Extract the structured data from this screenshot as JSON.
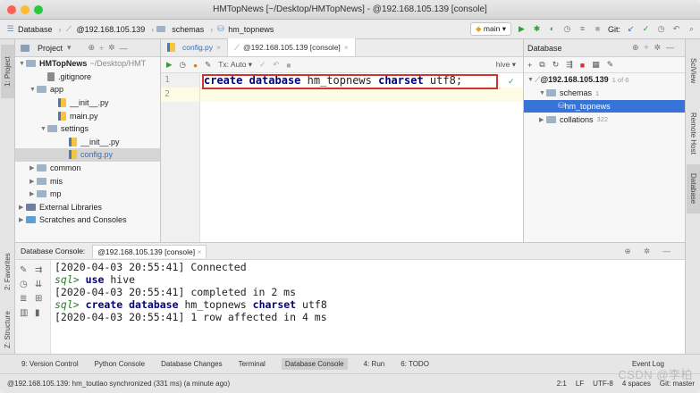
{
  "window": {
    "title": "HMTopNews [~/Desktop/HMTopNews] - @192.168.105.139 [console]"
  },
  "navbar": {
    "crumbs": [
      "Database",
      "@192.168.105.139",
      "schemas",
      "hm_topnews"
    ],
    "branch": "main",
    "git_label": "Git:"
  },
  "project": {
    "header": "Project",
    "items": [
      {
        "label": "HMTopNews",
        "suffix": "~/Desktop/HMT",
        "type": "folder",
        "indent": 0,
        "open": true
      },
      {
        "label": ".gitignore",
        "type": "file",
        "indent": 2
      },
      {
        "label": "app",
        "type": "folder",
        "indent": 1,
        "open": true
      },
      {
        "label": "__init__.py",
        "type": "py",
        "indent": 3
      },
      {
        "label": "main.py",
        "type": "py",
        "indent": 3
      },
      {
        "label": "settings",
        "type": "folder",
        "indent": 2,
        "open": true
      },
      {
        "label": "__init__.py",
        "type": "py",
        "indent": 4
      },
      {
        "label": "config.py",
        "type": "py",
        "indent": 4,
        "selected": true
      },
      {
        "label": "common",
        "type": "folder",
        "indent": 1
      },
      {
        "label": "mis",
        "type": "folder",
        "indent": 1
      },
      {
        "label": "mp",
        "type": "folder",
        "indent": 1
      },
      {
        "label": "External Libraries",
        "type": "lib",
        "indent": 0
      },
      {
        "label": "Scratches and Consoles",
        "type": "scratch",
        "indent": 0
      }
    ]
  },
  "editor": {
    "tabs": [
      {
        "label": "config.py",
        "active": false
      },
      {
        "label": "@192.168.105.139 [console]",
        "active": true
      }
    ],
    "tx": "Tx: Auto",
    "schema": "hive",
    "line_numbers": [
      "1",
      "2"
    ],
    "code": {
      "kw1": "create",
      "kw2": "database",
      "name": "hm_topnews",
      "kw3": "charset",
      "rest": "utf8;"
    }
  },
  "db_panel": {
    "header": "Database",
    "items": [
      {
        "label": "@192.168.105.139",
        "extra": "1 of 6",
        "indent": 0
      },
      {
        "label": "schemas",
        "extra": "1",
        "indent": 1
      },
      {
        "label": "hm_topnews",
        "extra": "",
        "indent": 2,
        "selected": true
      },
      {
        "label": "collations",
        "extra": "322",
        "indent": 1
      }
    ]
  },
  "console": {
    "tabs_label": "Database Console:",
    "tab": "@192.168.105.139 [console]",
    "lines": [
      {
        "kind": "log",
        "text": "[2020-04-03 20:55:41] Connected"
      },
      {
        "kind": "cmd",
        "prompt": "sql>",
        "kw": "use",
        "rest": "hive"
      },
      {
        "kind": "log",
        "text": "[2020-04-03 20:55:41] completed in 2 ms"
      },
      {
        "kind": "cmd2",
        "prompt": "sql>",
        "kw1": "create",
        "kw2": "database",
        "name": "hm_topnews",
        "kw3": "charset",
        "rest": "utf8"
      },
      {
        "kind": "log",
        "text": "[2020-04-03 20:55:41] 1 row affected in 4 ms"
      }
    ]
  },
  "left_tabs": [
    "1: Project",
    "2: Favorites",
    "Z: Structure"
  ],
  "right_tabs": [
    "SciView",
    "Remote Host",
    "Database"
  ],
  "bottom_tabs": [
    "9: Version Control",
    "Python Console",
    "Database Changes",
    "Terminal",
    "Database Console",
    "4: Run",
    "6: TODO",
    "Event Log"
  ],
  "status": {
    "left": "@192.168.105.139: hm_toutiao synchronized (331 ms) (a minute ago)",
    "pos": "2:1",
    "lf": "LF",
    "enc": "UTF-8",
    "spaces": "4 spaces",
    "git": "Git: master"
  },
  "watermark": "CSDN @李柏"
}
